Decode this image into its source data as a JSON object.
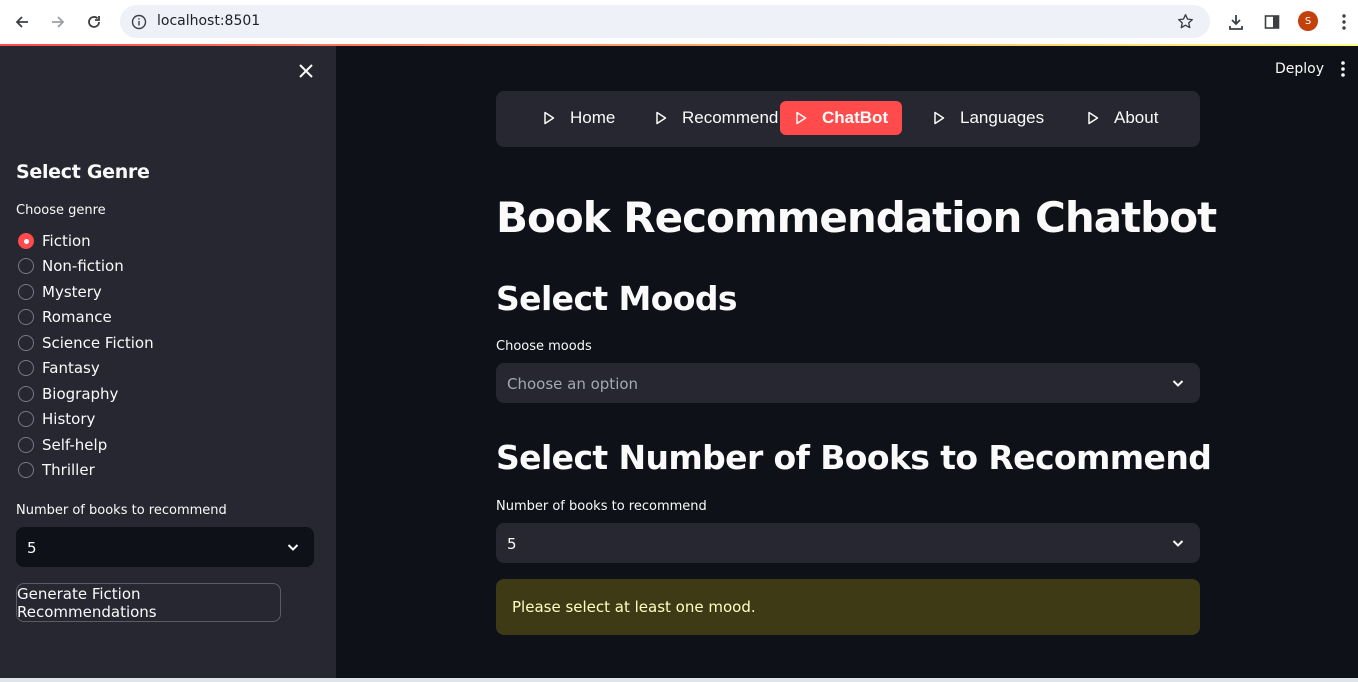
{
  "browser": {
    "url": "localhost:8501",
    "profile_initial": "S"
  },
  "header": {
    "deploy_label": "Deploy"
  },
  "sidebar": {
    "title": "Select Genre",
    "genre_label": "Choose genre",
    "genres": [
      "Fiction",
      "Non-fiction",
      "Mystery",
      "Romance",
      "Science Fiction",
      "Fantasy",
      "Biography",
      "History",
      "Self-help",
      "Thriller"
    ],
    "selected_genre": "Fiction",
    "count_label": "Number of books to recommend",
    "count_value": "5",
    "generate_button": "Generate Fiction Recommendations"
  },
  "menu": {
    "items": [
      {
        "label": "Home",
        "active": false
      },
      {
        "label": "Recommend",
        "active": false
      },
      {
        "label": "ChatBot",
        "active": true
      },
      {
        "label": "Languages",
        "active": false
      },
      {
        "label": "About",
        "active": false
      }
    ],
    "accent_color": "#ff4b4b"
  },
  "main": {
    "title": "Book Recommendation Chatbot",
    "moods_heading": "Select Moods",
    "moods_label": "Choose moods",
    "moods_placeholder": "Choose an option",
    "count_heading": "Select Number of Books to Recommend",
    "count_label": "Number of books to recommend",
    "count_value": "5",
    "warning": "Please select at least one mood."
  },
  "icons": [
    "back-arrow-icon",
    "forward-arrow-icon",
    "reload-icon",
    "site-info-icon",
    "bookmark-star-icon",
    "download-icon",
    "side-panel-icon",
    "more-menu-icon",
    "close-icon",
    "play-icon",
    "chevron-down-icon"
  ]
}
